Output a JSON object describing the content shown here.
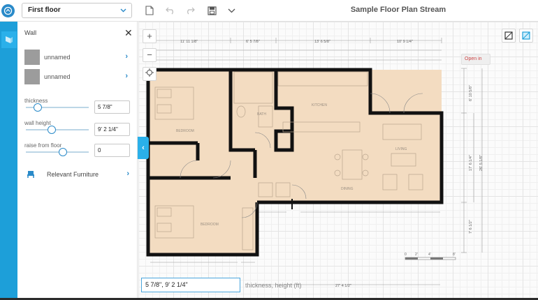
{
  "toolbar": {
    "floor_select": "First floor",
    "title": "Sample Floor Plan Stream"
  },
  "panel": {
    "title": "Wall",
    "materials": [
      {
        "label": "unnamed"
      },
      {
        "label": "unnamed"
      }
    ],
    "thickness": {
      "label": "thickness",
      "value": "5 7/8\"",
      "slider": 0.12
    },
    "wall_height": {
      "label": "wall height",
      "value": "9' 2 1/4\"",
      "slider": 0.34
    },
    "raise_from_floor": {
      "label": "raise from floor",
      "value": "0",
      "slider": 0.52
    },
    "furniture_label": "Relevant Furniture"
  },
  "canvas": {
    "open_button": "Open in",
    "dimension_input": "5 7/8\", 9' 2 1/4\"",
    "dimension_hint": "thickness, height (ft)",
    "dims": {
      "top1": "11' 11 1/8\"",
      "top2": "6' 5 7/8\"",
      "top3": "13' 6 5/8\"",
      "top4": "10' 9 1/4\"",
      "right1": "6' 10 5/8\"",
      "right2": "17' 6 1/4\"",
      "right3": "26' 5 1/8\"",
      "right4": "7' 6 1/2\"",
      "bottom": "27' 4 1/2\"",
      "scale": [
        "0",
        "2'",
        "4'",
        "8'"
      ]
    },
    "rooms": {
      "bedroom1": "BEDROOM",
      "bath": "BATH",
      "kitchen": "KITCHEN",
      "living": "LIVING",
      "dining": "DINING",
      "bedroom2": "BEDROOM"
    }
  },
  "colors": {
    "accent": "#1d9fd9",
    "floor": "#f3dcc1",
    "wall": "#111111"
  }
}
